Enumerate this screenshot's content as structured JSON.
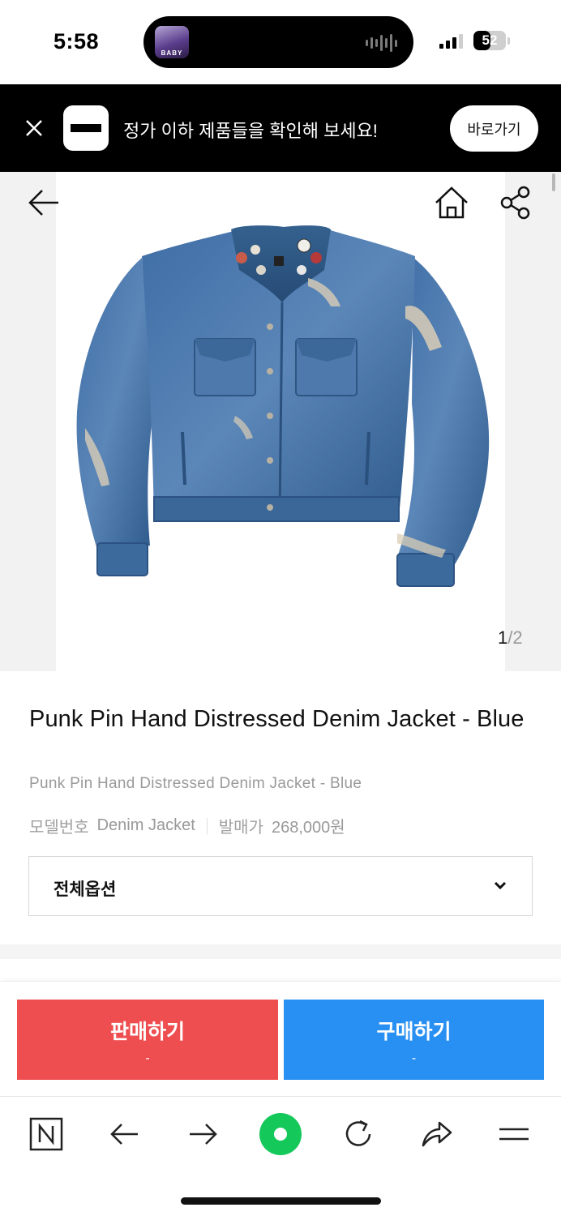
{
  "status_bar": {
    "time": "5:58",
    "now_playing_art_label": "BABY",
    "battery": "52",
    "battery_level": 0.52
  },
  "banner": {
    "message": "정가 이하 제품들을 확인해 보세요!",
    "button_label": "바로가기"
  },
  "gallery": {
    "current": "1",
    "separator": "/",
    "total": "2"
  },
  "product": {
    "title": "Punk Pin Hand Distressed Denim Jacket - Blue",
    "subtitle": "Punk Pin Hand Distressed Denim Jacket - Blue",
    "model_label": "모델번호",
    "model_value": "Denim Jacket",
    "release_price_label": "발매가",
    "release_price_value": "268,000원"
  },
  "options": {
    "label": "전체옵션"
  },
  "actions": {
    "sell_label": "판매하기",
    "sell_price": "-",
    "buy_label": "구매하기",
    "buy_price": "-"
  },
  "colors": {
    "sell": "#ef4e50",
    "buy": "#2990f3",
    "browser_accent": "#14c85a"
  }
}
